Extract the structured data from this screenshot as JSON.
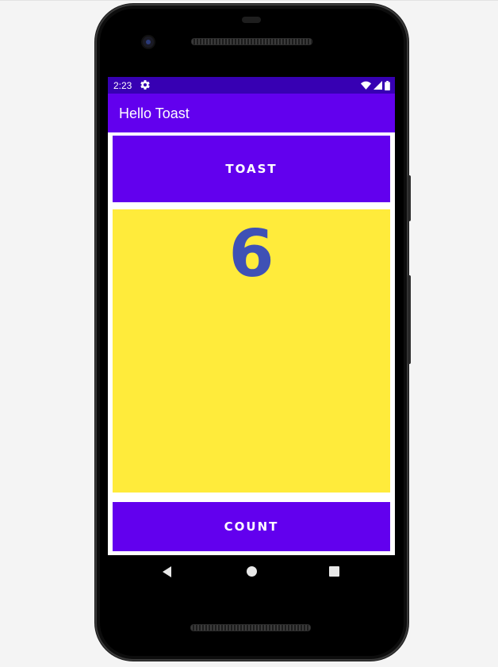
{
  "status_bar": {
    "time": "2:23",
    "icons": [
      "settings-icon",
      "wifi-icon",
      "signal-icon",
      "battery-icon"
    ]
  },
  "app_bar": {
    "title": "Hello Toast"
  },
  "toast_button": {
    "label": "TOAST"
  },
  "counter": {
    "value": "6"
  },
  "count_button": {
    "label": "COUNT"
  },
  "nav_bar": {
    "icons": [
      "back-icon",
      "home-icon",
      "recents-icon"
    ]
  },
  "colors": {
    "status_bar": "#3700b3",
    "primary": "#6200ee",
    "counter_background": "#ffeb3b",
    "counter_text": "#3f51b5"
  }
}
